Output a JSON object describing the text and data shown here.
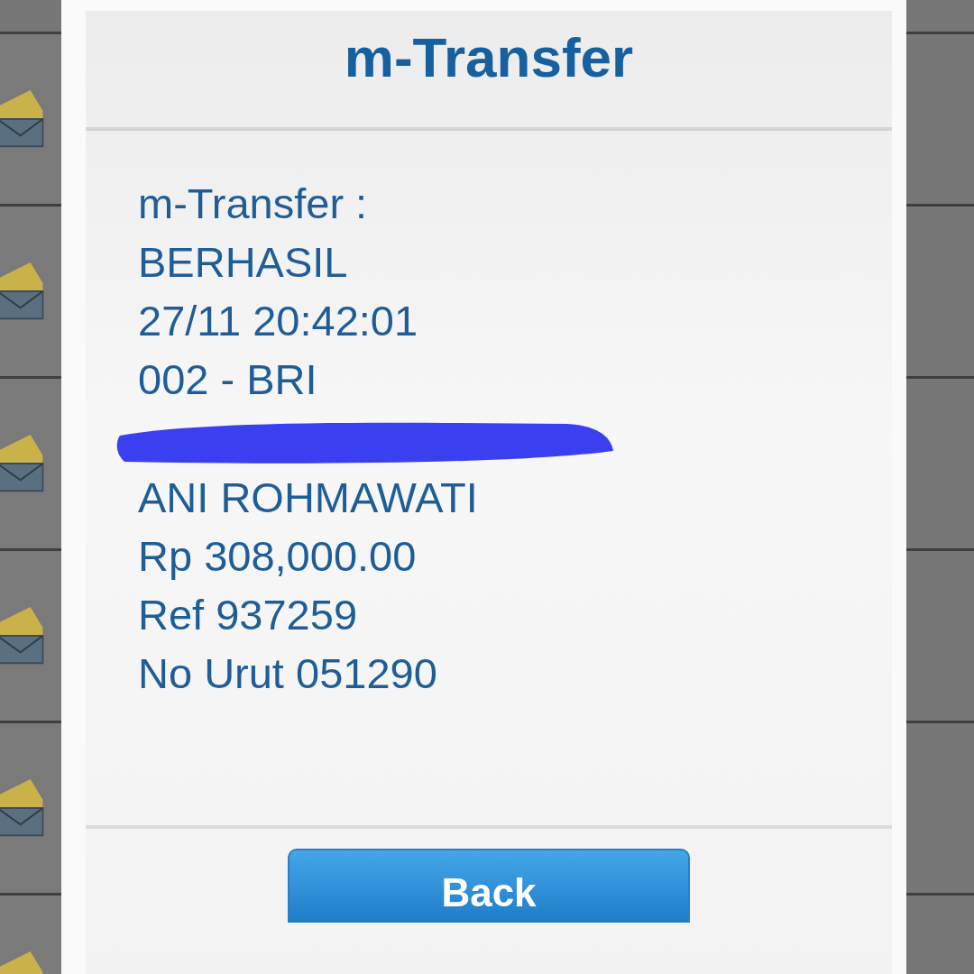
{
  "dialog": {
    "title": "m-Transfer",
    "lines": [
      {
        "kind": "text",
        "text": "m-Transfer :"
      },
      {
        "kind": "text",
        "text": "BERHASIL"
      },
      {
        "kind": "text",
        "text": "27/11 20:42:01"
      },
      {
        "kind": "text",
        "text": "002 - BRI"
      },
      {
        "kind": "redacted"
      },
      {
        "kind": "text",
        "text": "ANI ROHMAWATI"
      },
      {
        "kind": "text",
        "text": "Rp 308,000.00"
      },
      {
        "kind": "text",
        "text": "Ref 937259"
      },
      {
        "kind": "text",
        "text": "No Urut 051290"
      }
    ],
    "button": {
      "label": "Back"
    }
  }
}
